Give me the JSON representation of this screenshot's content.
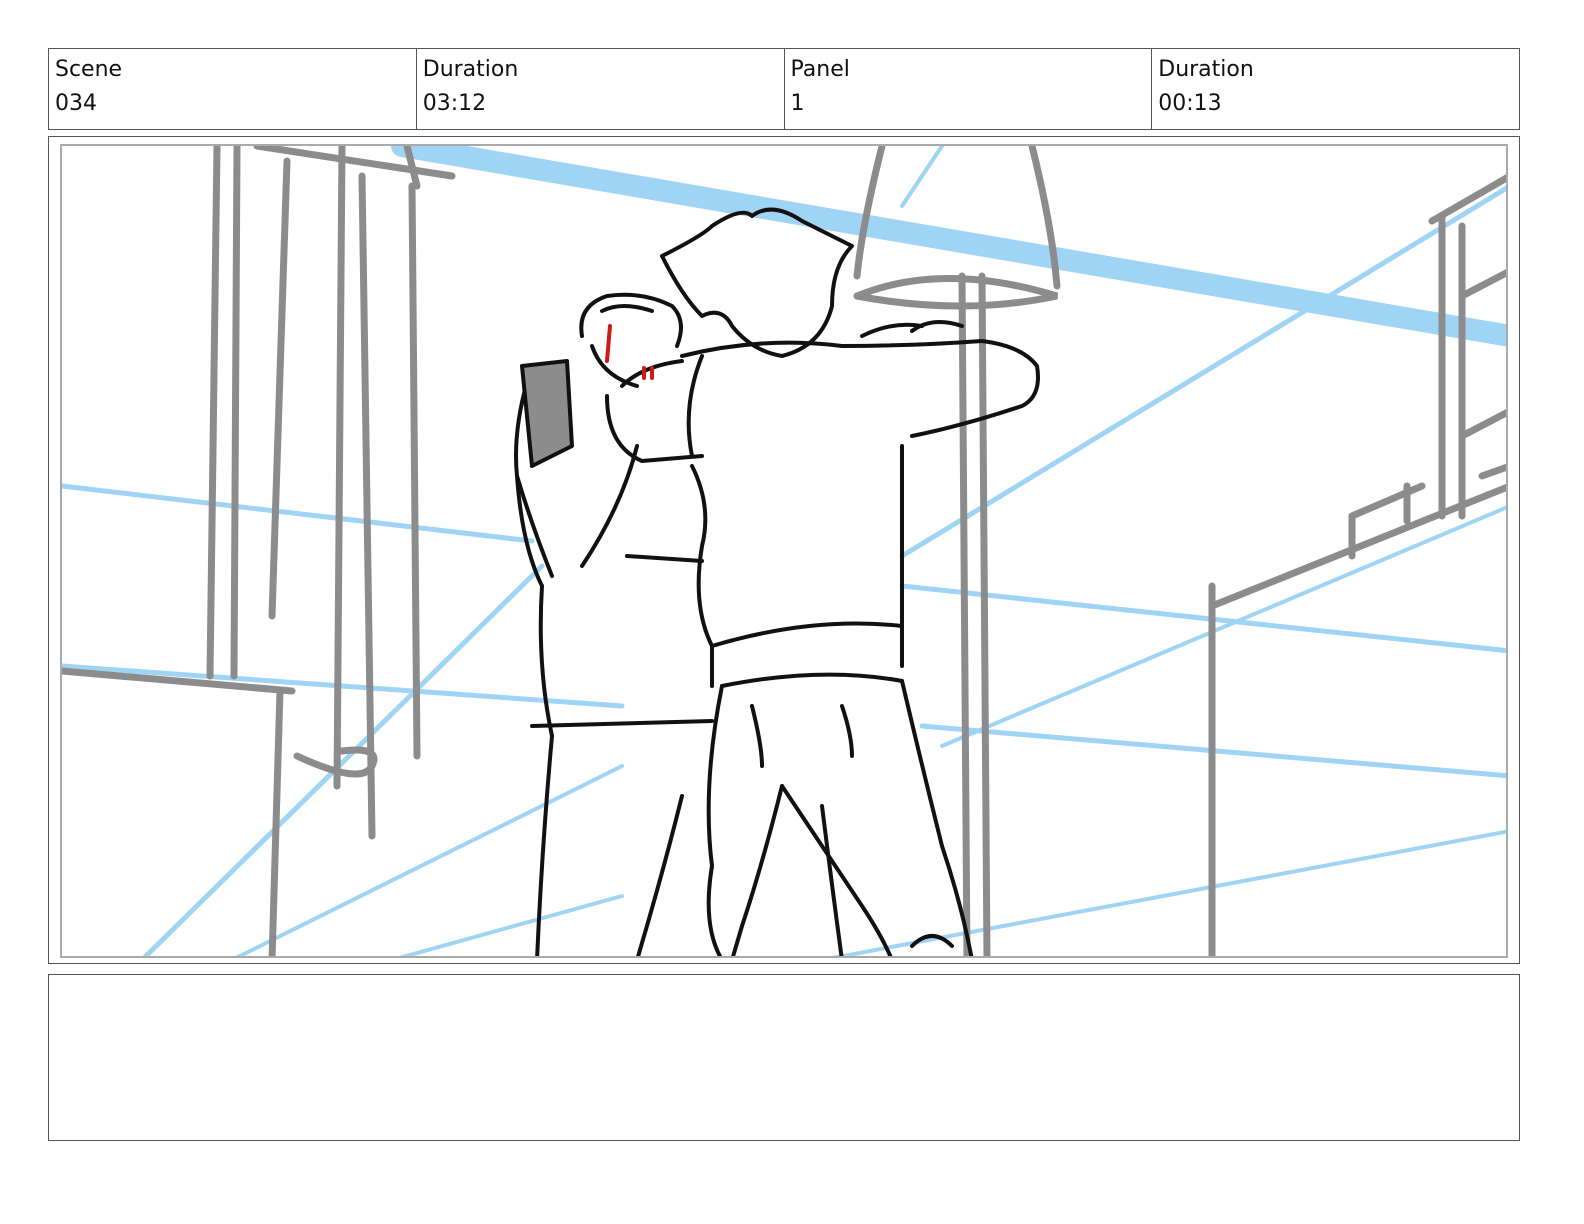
{
  "header": {
    "scene_label": "Scene",
    "scene_value": "034",
    "duration_label": "Duration",
    "duration_value": "03:12",
    "panel_label": "Panel",
    "panel_value": "1",
    "panel_duration_label": "Duration",
    "panel_duration_value": "00:13"
  },
  "panel": {
    "colors": {
      "perspective": "#9fd4f5",
      "background_gray": "#8c8c8c",
      "ink": "#111111",
      "blood": "#cc1a1a"
    }
  },
  "notes": {
    "text": ""
  }
}
